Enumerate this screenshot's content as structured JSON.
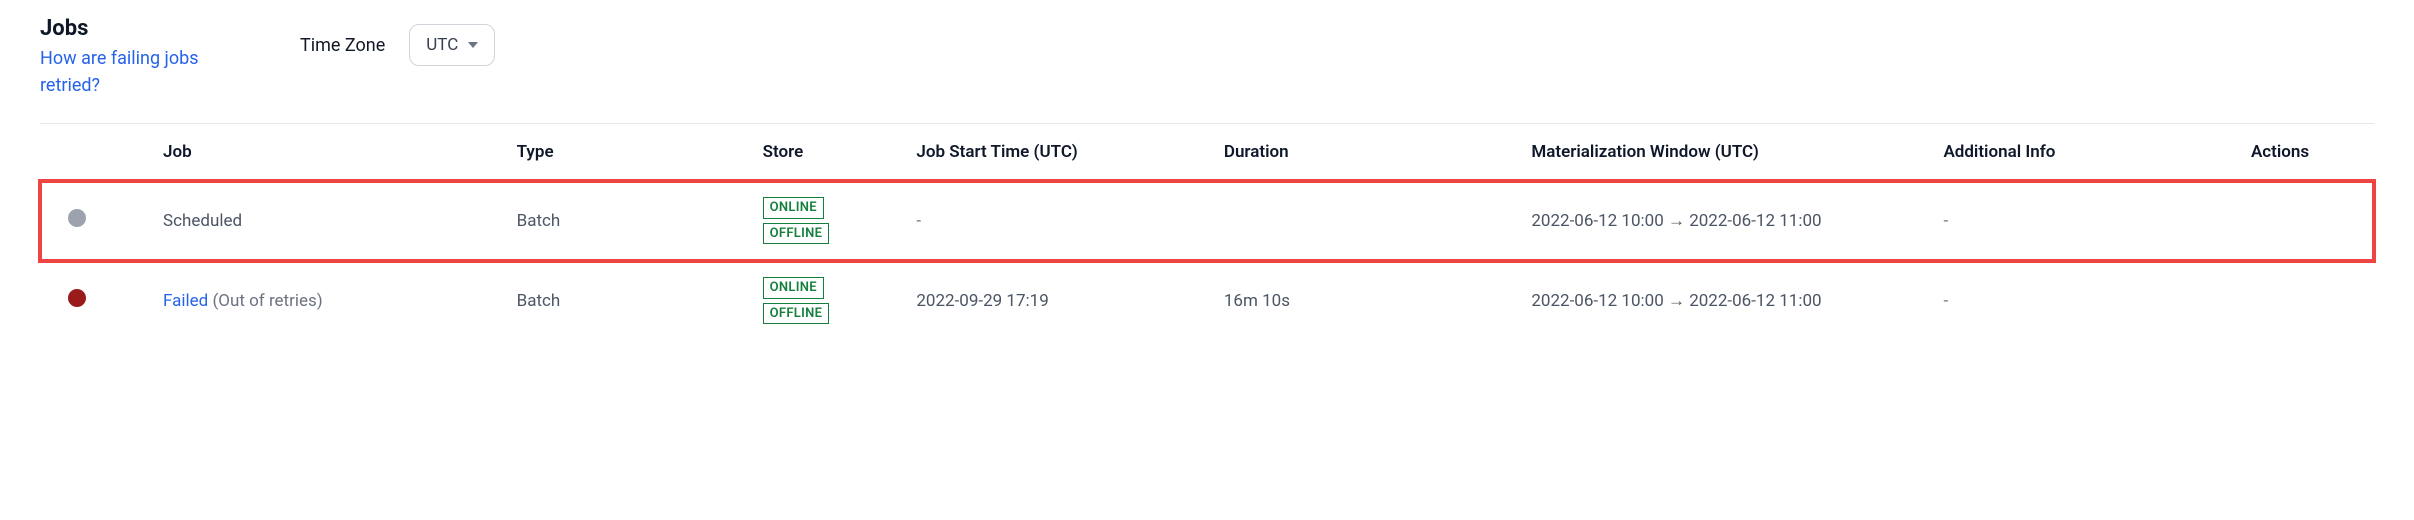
{
  "header": {
    "title": "Jobs",
    "help_link_text": "How are failing jobs retried?",
    "timezone_label": "Time Zone",
    "timezone_value": "UTC"
  },
  "columns": {
    "job": "Job",
    "type": "Type",
    "store": "Store",
    "start_time": "Job Start Time (UTC)",
    "duration": "Duration",
    "materialization_window": "Materialization Window (UTC)",
    "additional_info": "Additional Info",
    "actions": "Actions"
  },
  "store_labels": {
    "online": "ONLINE",
    "offline": "OFFLINE"
  },
  "rows": [
    {
      "status_dot": "gray",
      "job_label": "Scheduled",
      "job_is_link": false,
      "job_suffix": "",
      "type": "Batch",
      "stores": [
        "online",
        "offline"
      ],
      "start_time": "-",
      "duration": "",
      "window": "2022-06-12 10:00 → 2022-06-12 11:00",
      "additional": "-",
      "highlight": true
    },
    {
      "status_dot": "red",
      "job_label": "Failed",
      "job_is_link": true,
      "job_suffix": "(Out of retries)",
      "type": "Batch",
      "stores": [
        "online",
        "offline"
      ],
      "start_time": "2022-09-29 17:19",
      "duration": "16m 10s",
      "window": "2022-06-12 10:00 → 2022-06-12 11:00",
      "additional": "-",
      "highlight": false
    }
  ]
}
